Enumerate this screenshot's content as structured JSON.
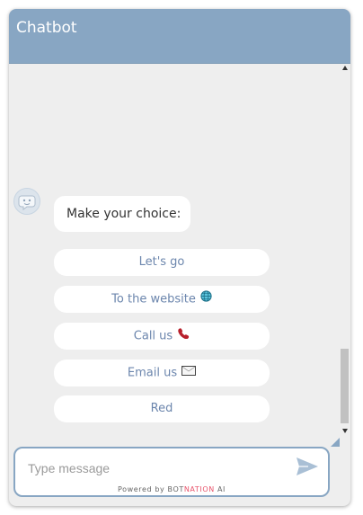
{
  "header": {
    "title": "Chatbot"
  },
  "conversation": {
    "bot_message": "Make your choice:",
    "choices": [
      {
        "label": "Let's go",
        "icon": ""
      },
      {
        "label": "To the website",
        "icon": "globe-icon"
      },
      {
        "label": "Call us",
        "icon": "telephone-icon"
      },
      {
        "label": "Email us",
        "icon": "envelope-icon"
      },
      {
        "label": "Red",
        "icon": ""
      }
    ]
  },
  "composer": {
    "placeholder": "Type message",
    "powered_prefix": "Powered by ",
    "brand_part1": "BOT",
    "brand_part2": "NATION",
    "brand_part3": " AI"
  },
  "colors": {
    "header": "#88a6c3",
    "panel": "#eeeeee",
    "choice_text": "#6c86ad",
    "brand_accent": "#e8546b"
  }
}
